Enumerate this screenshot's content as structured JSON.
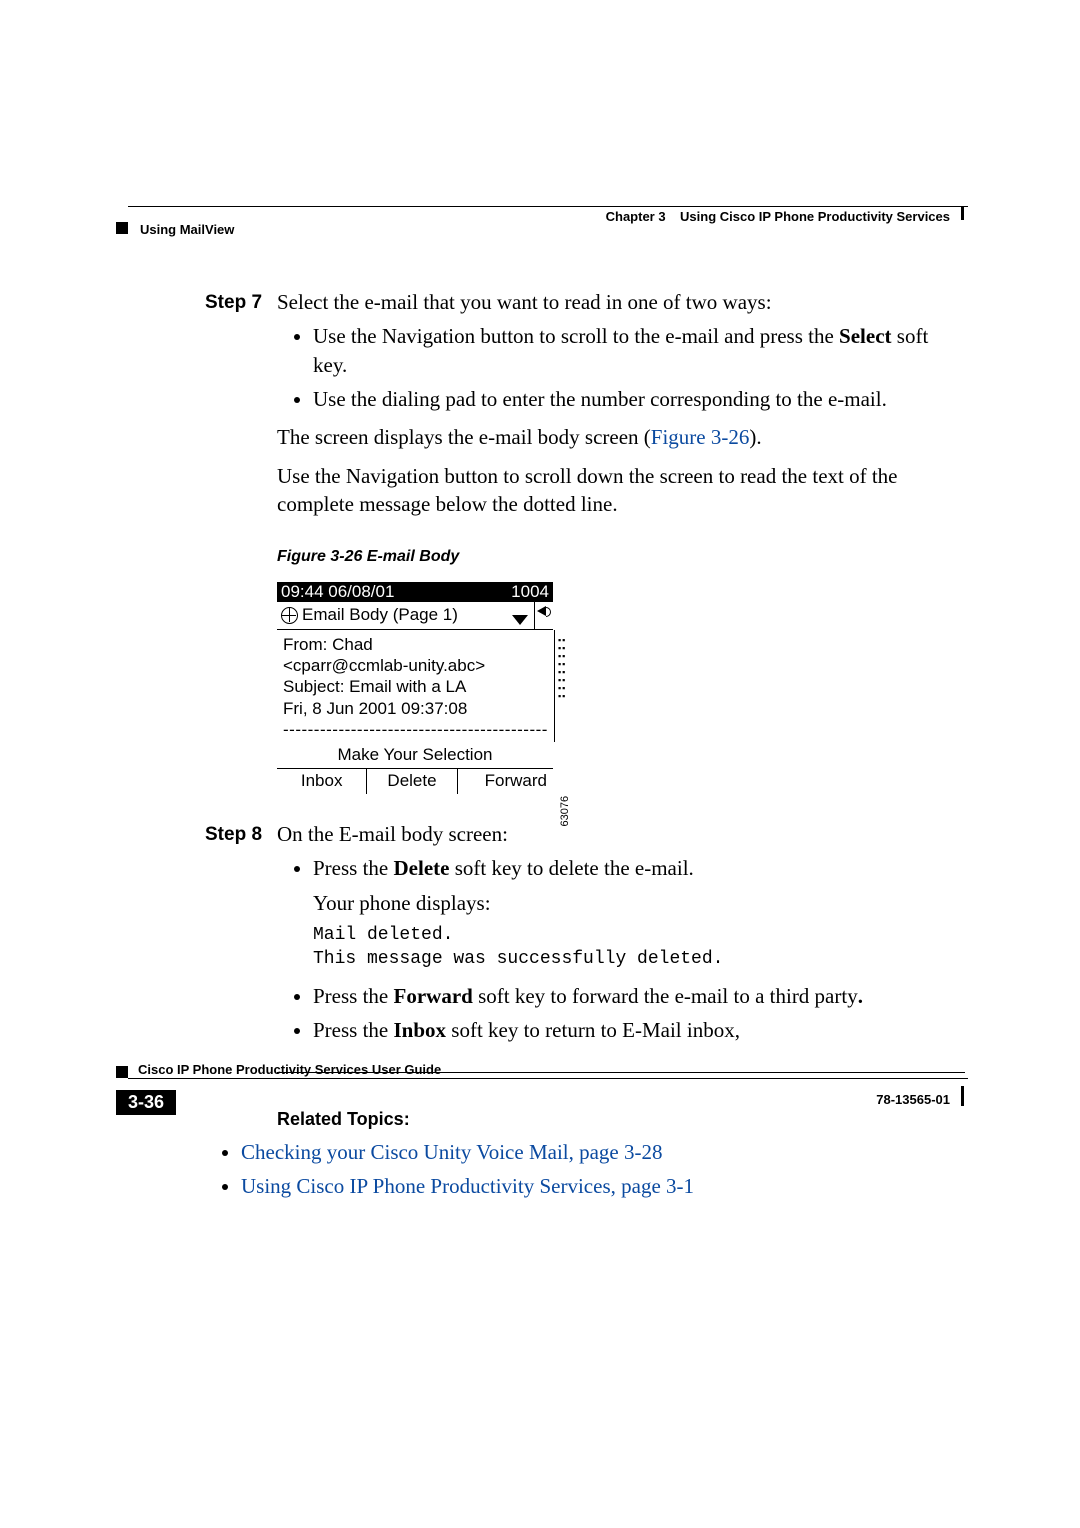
{
  "header": {
    "chapter_label": "Chapter 3",
    "chapter_title": "Using Cisco IP Phone Productivity Services",
    "section": "Using MailView"
  },
  "step7": {
    "label": "Step 7",
    "intro": "Select the e-mail that you want to read in one of two ways:",
    "bullets": {
      "b1_pre": "Use the Navigation button to scroll to the e-mail and press the ",
      "b1_bold": "Select",
      "b1_post": " soft key.",
      "b2": "Use the dialing pad to enter the number corresponding to the e-mail."
    },
    "after1_pre": "The screen displays the e-mail body screen (",
    "after1_link": "Figure 3-26",
    "after1_post": ").",
    "after2": "Use the Navigation button to scroll down the screen to read the text of the complete message below the dotted line."
  },
  "figure": {
    "caption": "Figure 3-26   E-mail Body",
    "id": "63076",
    "top_left": "09:44 06/08/01",
    "top_right": "1004",
    "title": "Email Body (Page 1)",
    "from": "From: Chad",
    "addr": "<cparr@ccmlab-unity.abc>",
    "subject": "Subject: Email with a LA",
    "date": "Fri, 8 Jun 2001 09:37:08",
    "divider": "-------------------------------------------",
    "prompt": "Make Your Selection",
    "soft1": "Inbox",
    "soft2": "Delete",
    "soft3": "Forward"
  },
  "step8": {
    "label": "Step 8",
    "intro": "On the E-mail body screen:",
    "b1_pre": "Press the ",
    "b1_bold": "Delete",
    "b1_post": " soft key to delete the e-mail.",
    "b1_line2": "Your phone displays:",
    "code": "Mail deleted.\nThis message was successfully deleted.",
    "b2_pre": "Press the ",
    "b2_bold": "Forward",
    "b2_post": " soft key to forward the e-mail to a third party",
    "b2_dot": ".",
    "b3_pre": "Press the ",
    "b3_bold": "Inbox",
    "b3_post": " soft key to return to E-Mail inbox,"
  },
  "related": {
    "heading": "Related Topics:",
    "links": [
      "Checking your Cisco Unity Voice Mail, page 3-28",
      "Using Cisco IP Phone Productivity Services, page 3-1"
    ]
  },
  "footer": {
    "guide": "Cisco IP Phone Productivity Services User Guide",
    "page": "3-36",
    "docnum": "78-13565-01"
  }
}
